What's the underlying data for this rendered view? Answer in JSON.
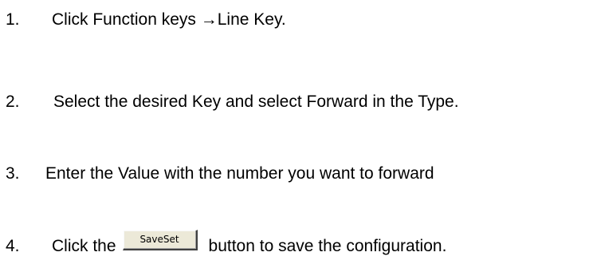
{
  "steps": [
    {
      "number": "1.",
      "text": "Click Function keys  →Line Key."
    },
    {
      "number": "2.",
      "text": "Select the desired Key and select Forward in the Type."
    },
    {
      "number": "3.",
      "text": "Enter the Value with the number you want to forward"
    },
    {
      "number": "4.",
      "text_before": "Click the",
      "button_label": "SaveSet",
      "text_after": "button to save the configuration."
    }
  ]
}
